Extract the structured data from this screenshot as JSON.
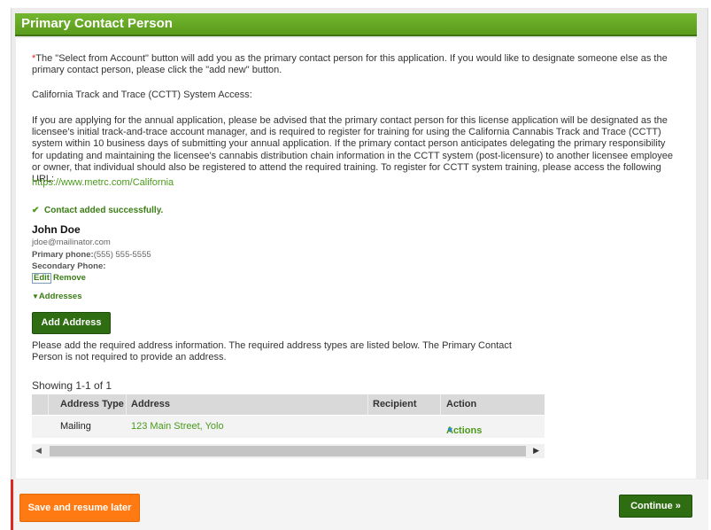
{
  "panel": {
    "title": "Primary Contact Person"
  },
  "intro": {
    "asterisk": "*",
    "paragraph1": "The \"Select from Account\" button will add you as the primary contact person for this application. If you would like to designate someone else as the primary contact person, please click the \"add new\" button.",
    "paragraph2": "California Track and Trace (CCTT) System Access:",
    "paragraph3": "If you are applying for the annual application, please be advised that the primary contact person for this license application will be designated as the licensee's initial track-and-trace account manager, and is required to register for training for using the California Cannabis Track and Trace (CCTT) system within 10 business days of submitting your annual application. If the primary contact person anticipates delegating the primary responsibility for updating and maintaining the licensee's cannabis distribution chain information in the CCTT system (post-licensure) to another licensee employee or owner, that individual should also be registered to attend the required training. To register for CCTT system training, please access the following URL:",
    "url": "https://www.metrc.com/California"
  },
  "contact": {
    "success_message": "Contact added successfully.",
    "name": "John  Doe",
    "email": "jdoe@mailinator.com",
    "primary_phone_label": "Primary phone:",
    "primary_phone": "(555) 555-5555",
    "secondary_phone_label": "Secondary Phone:",
    "edit_label": "Edit",
    "remove_label": "Remove",
    "addresses_label": "Addresses"
  },
  "addresses": {
    "add_button": "Add Address",
    "instructions": "Please add the required address information. The required address types are listed below. The Primary Contact Person is not required to provide an address.",
    "showing": "Showing 1-1 of 1",
    "columns": [
      "Address Type",
      "Address",
      "Recipient",
      "Action"
    ],
    "rows": [
      {
        "type": "Mailing",
        "address": "123 Main Street, Yolo",
        "recipient": "",
        "action": "Actions"
      }
    ]
  },
  "footer": {
    "save_label": "Save and resume later",
    "continue_label": "Continue »"
  },
  "colors": {
    "header_green": "#5a9c1c",
    "link_green": "#4a9a1b",
    "button_dark_green": "#2f6d12",
    "save_orange": "#ff7a13",
    "required_red": "#d9261c"
  },
  "icons": [
    "check-icon",
    "caret-down-icon",
    "scroll-left-icon",
    "scroll-right-icon"
  ]
}
